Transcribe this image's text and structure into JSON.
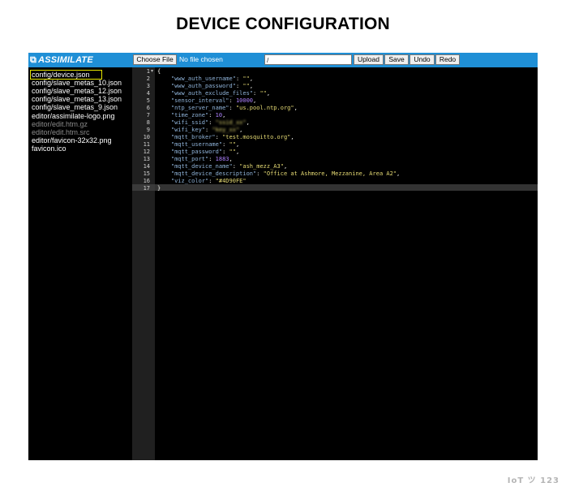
{
  "page_title": "DEVICE CONFIGURATION",
  "toolbar": {
    "logo_text": "ASSIMILATE",
    "choose_file_label": "Choose File",
    "no_file_label": "No file chosen",
    "path_value": "/",
    "upload_label": "Upload",
    "save_label": "Save",
    "undo_label": "Undo",
    "redo_label": "Redo"
  },
  "files": [
    {
      "name": "config/device.json",
      "selected": true
    },
    {
      "name": "config/slave_metas_10.json"
    },
    {
      "name": "config/slave_metas_12.json"
    },
    {
      "name": "config/slave_metas_13.json"
    },
    {
      "name": "config/slave_metas_9.json"
    },
    {
      "name": "editor/assimilate-logo.png"
    },
    {
      "name": "editor/edit.htm.gz",
      "dim": true
    },
    {
      "name": "editor/edit.htm.src",
      "dim": true
    },
    {
      "name": "editor/favicon-32x32.png"
    },
    {
      "name": "favicon.ico"
    }
  ],
  "editor": {
    "line_numbers": [
      "1",
      "2",
      "3",
      "4",
      "5",
      "6",
      "7",
      "8",
      "9",
      "10",
      "11",
      "12",
      "13",
      "14",
      "15",
      "16",
      "17"
    ],
    "lines": [
      {
        "punct_open": "{"
      },
      {
        "key": "\"www_auth_username\"",
        "value": "\"\"",
        "vtype": "s"
      },
      {
        "key": "\"www_auth_password\"",
        "value": "\"\"",
        "vtype": "s"
      },
      {
        "key": "\"www_auth_exclude_files\"",
        "value": "\"\"",
        "vtype": "s"
      },
      {
        "key": "\"sensor_interval\"",
        "value": "10000",
        "vtype": "n"
      },
      {
        "key": "\"ntp_server_name\"",
        "value": "\"us.pool.ntp.org\"",
        "vtype": "s"
      },
      {
        "key": "\"time_zone\"",
        "value": "10",
        "vtype": "n"
      },
      {
        "key": "\"wifi_ssid\"",
        "value": "\"ssid_xx\"",
        "vtype": "s",
        "blurred": true
      },
      {
        "key": "\"wifi_key\"",
        "value": "\"key_xx\"",
        "vtype": "s",
        "blurred": true
      },
      {
        "key": "\"mqtt_broker\"",
        "value": "\"test.mosquitto.org\"",
        "vtype": "s"
      },
      {
        "key": "\"mqtt_username\"",
        "value": "\"\"",
        "vtype": "s"
      },
      {
        "key": "\"mqtt_password\"",
        "value": "\"\"",
        "vtype": "s"
      },
      {
        "key": "\"mqtt_port\"",
        "value": "1883",
        "vtype": "n"
      },
      {
        "key": "\"mqtt_device_name\"",
        "value": "\"ash_mezz_A3\"",
        "vtype": "s"
      },
      {
        "key": "\"mqtt_device_description\"",
        "value": "\"Office at Ashmore, Mezzanine, Area A2\"",
        "vtype": "s"
      },
      {
        "key": "\"viz_color\"",
        "value": "\"#4D90FE\"",
        "vtype": "s",
        "last": true
      },
      {
        "punct_close": "}"
      }
    ]
  },
  "watermark": "IoT ツ 123"
}
